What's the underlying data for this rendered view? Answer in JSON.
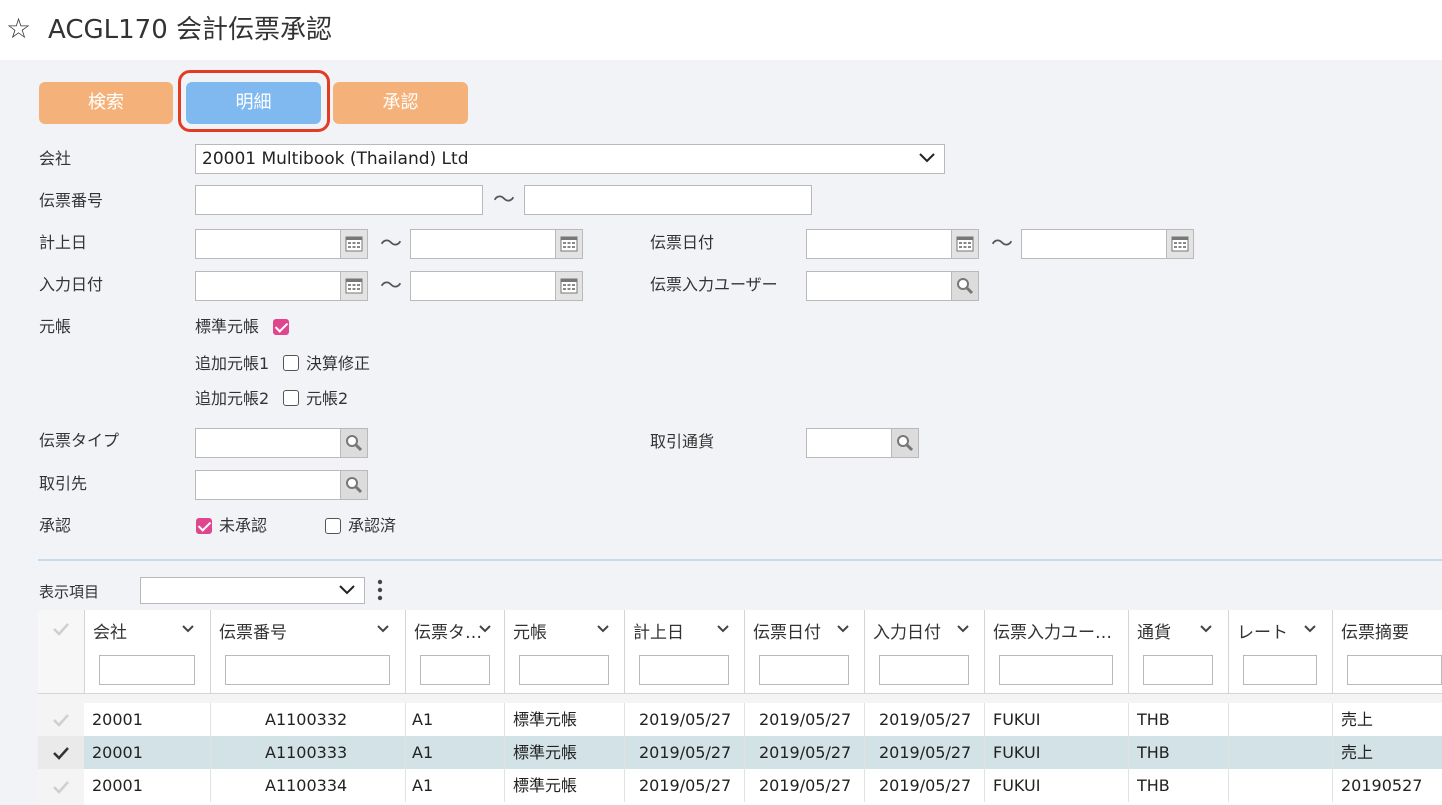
{
  "title": {
    "star": "☆",
    "text": "ACGL170 会計伝票承認"
  },
  "toolbar": {
    "search_label": "検索",
    "detail_label": "明細",
    "approve_label": "承認"
  },
  "form": {
    "company_label": "会社",
    "company_value": "20001 Multibook (Thailand) Ltd",
    "voucher_no_label": "伝票番号",
    "posting_date_label": "計上日",
    "voucher_date_label": "伝票日付",
    "entry_date_label": "入力日付",
    "entry_user_label": "伝票入力ユーザー",
    "ledger_label": "元帳",
    "ledger_standard": "標準元帳",
    "ledger_add1": "追加元帳1",
    "ledger_closing": "決算修正",
    "ledger_add2": "追加元帳2",
    "ledger_2": "元帳2",
    "voucher_type_label": "伝票タイプ",
    "currency_label": "取引通貨",
    "partner_label": "取引先",
    "approval_label": "承認",
    "unapproved": "未承認",
    "approved": "承認済",
    "tilde": "〜"
  },
  "grid": {
    "display_items_label": "表示項目",
    "columns": [
      "会社",
      "伝票番号",
      "伝票タ…",
      "元帳",
      "計上日",
      "伝票日付",
      "入力日付",
      "伝票入力ユー…",
      "通貨",
      "レート",
      "伝票摘要"
    ],
    "rows": [
      [
        "20001",
        "A1100332",
        "A1",
        "標準元帳",
        "2019/05/27",
        "2019/05/27",
        "2019/05/27",
        "FUKUI",
        "THB",
        "",
        "売上"
      ],
      [
        "20001",
        "A1100333",
        "A1",
        "標準元帳",
        "2019/05/27",
        "2019/05/27",
        "2019/05/27",
        "FUKUI",
        "THB",
        "",
        "売上"
      ],
      [
        "20001",
        "A1100334",
        "A1",
        "標準元帳",
        "2019/05/27",
        "2019/05/27",
        "2019/05/27",
        "FUKUI",
        "THB",
        "",
        "20190527"
      ]
    ]
  },
  "colors": {
    "orange_button": "#f4b27a",
    "blue_button": "#7fb9ef",
    "highlight_ring": "#e23c24",
    "checkbox_checked": "#e0468f",
    "selected_row": "#d3e2e7"
  }
}
